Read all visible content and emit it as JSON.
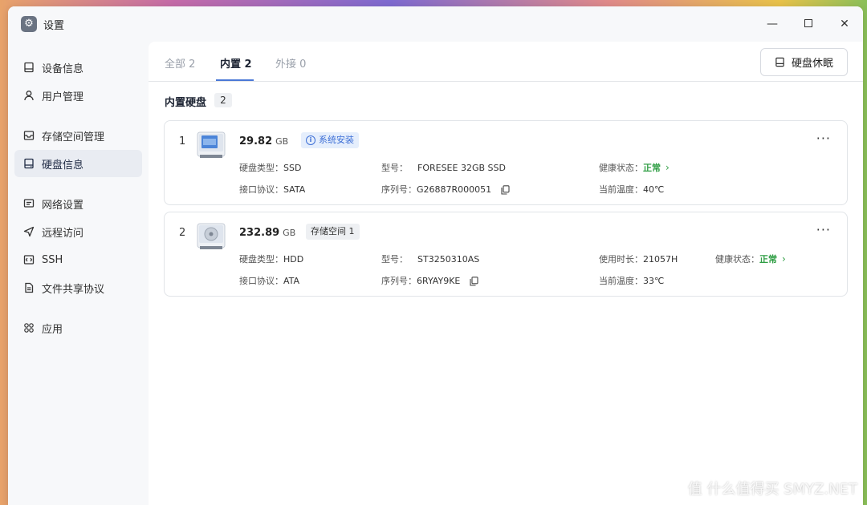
{
  "window": {
    "title": "设置",
    "controls": {
      "minimize": "—",
      "close": "✕"
    }
  },
  "sidebar": {
    "items": [
      {
        "label": "设备信息",
        "icon": "device-icon"
      },
      {
        "label": "用户管理",
        "icon": "user-icon"
      },
      {
        "label": "存储空间管理",
        "icon": "storage-icon"
      },
      {
        "label": "硬盘信息",
        "icon": "disk-icon",
        "active": true
      },
      {
        "label": "网络设置",
        "icon": "network-icon"
      },
      {
        "label": "远程访问",
        "icon": "send-icon"
      },
      {
        "label": "SSH",
        "icon": "code-icon"
      },
      {
        "label": "文件共享协议",
        "icon": "file-icon"
      },
      {
        "label": "应用",
        "icon": "apps-icon"
      }
    ]
  },
  "tabs": [
    {
      "label": "全部 2"
    },
    {
      "label": "内置 2",
      "active": true
    },
    {
      "label": "外接 0"
    }
  ],
  "toolbar": {
    "sleep_label": "硬盘休眠"
  },
  "section": {
    "title": "内置硬盘",
    "count": "2"
  },
  "disks": [
    {
      "index": "1",
      "size": "29.82",
      "unit": "GB",
      "badge": "系统安装",
      "type_label": "硬盘类型：",
      "type": "SSD",
      "interface_label": "接口协议：",
      "interface": "SATA",
      "model_label": "型号：",
      "model": "FORESEE 32GB SSD",
      "serial_label": "序列号：",
      "serial": "G26887R000051",
      "health_label": "健康状态：",
      "health": "正常",
      "temp_label": "当前温度：",
      "temp": "40℃",
      "disk_kind": "ssd-icon"
    },
    {
      "index": "2",
      "size": "232.89",
      "unit": "GB",
      "badge": "存储空间 1",
      "type_label": "硬盘类型：",
      "type": "HDD",
      "interface_label": "接口协议：",
      "interface": "ATA",
      "model_label": "型号：",
      "model": "ST3250310AS",
      "serial_label": "序列号：",
      "serial": "6RYAY9KE",
      "uptime_label": "使用时长：",
      "uptime": "21057H",
      "health_label": "健康状态：",
      "health": "正常",
      "temp_label": "当前温度：",
      "temp": "33℃",
      "disk_kind": "hdd-icon"
    }
  ],
  "watermark": "值 什么值得买 SMYZ.NET",
  "colors": {
    "accent": "#4a78d6",
    "ok": "#2f9e44"
  }
}
